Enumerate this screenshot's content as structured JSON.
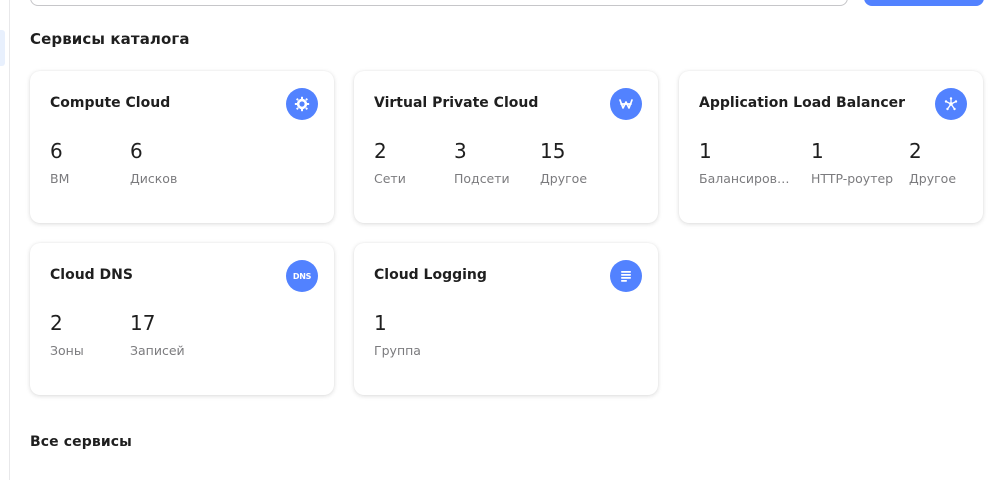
{
  "search": {
    "placeholder": "",
    "button_label": ""
  },
  "sections": {
    "catalog_title": "Сервисы каталога",
    "all_title": "Все сервисы"
  },
  "cards": [
    {
      "title": "Compute Cloud",
      "icon": "compute-icon",
      "stats": [
        {
          "value": "6",
          "label": "ВМ"
        },
        {
          "value": "6",
          "label": "Дисков"
        }
      ]
    },
    {
      "title": "Virtual Private Cloud",
      "icon": "network-icon",
      "stats": [
        {
          "value": "2",
          "label": "Сети"
        },
        {
          "value": "3",
          "label": "Подсети"
        },
        {
          "value": "15",
          "label": "Другое"
        }
      ]
    },
    {
      "title": "Application Load Balancer",
      "icon": "load-balancer-icon",
      "stats": [
        {
          "value": "1",
          "label": "Балансировщ..."
        },
        {
          "value": "1",
          "label": "HTTP-роутер"
        },
        {
          "value": "2",
          "label": "Другое"
        }
      ]
    },
    {
      "title": "Cloud DNS",
      "icon": "dns-icon",
      "icon_text": "DNS",
      "stats": [
        {
          "value": "2",
          "label": "Зоны"
        },
        {
          "value": "17",
          "label": "Записей"
        }
      ]
    },
    {
      "title": "Cloud Logging",
      "icon": "logging-icon",
      "stats": [
        {
          "value": "1",
          "label": "Группа"
        }
      ]
    }
  ],
  "colors": {
    "accent": "#5282ff",
    "text": "#1f1f1f",
    "muted": "#7b7b7e"
  }
}
